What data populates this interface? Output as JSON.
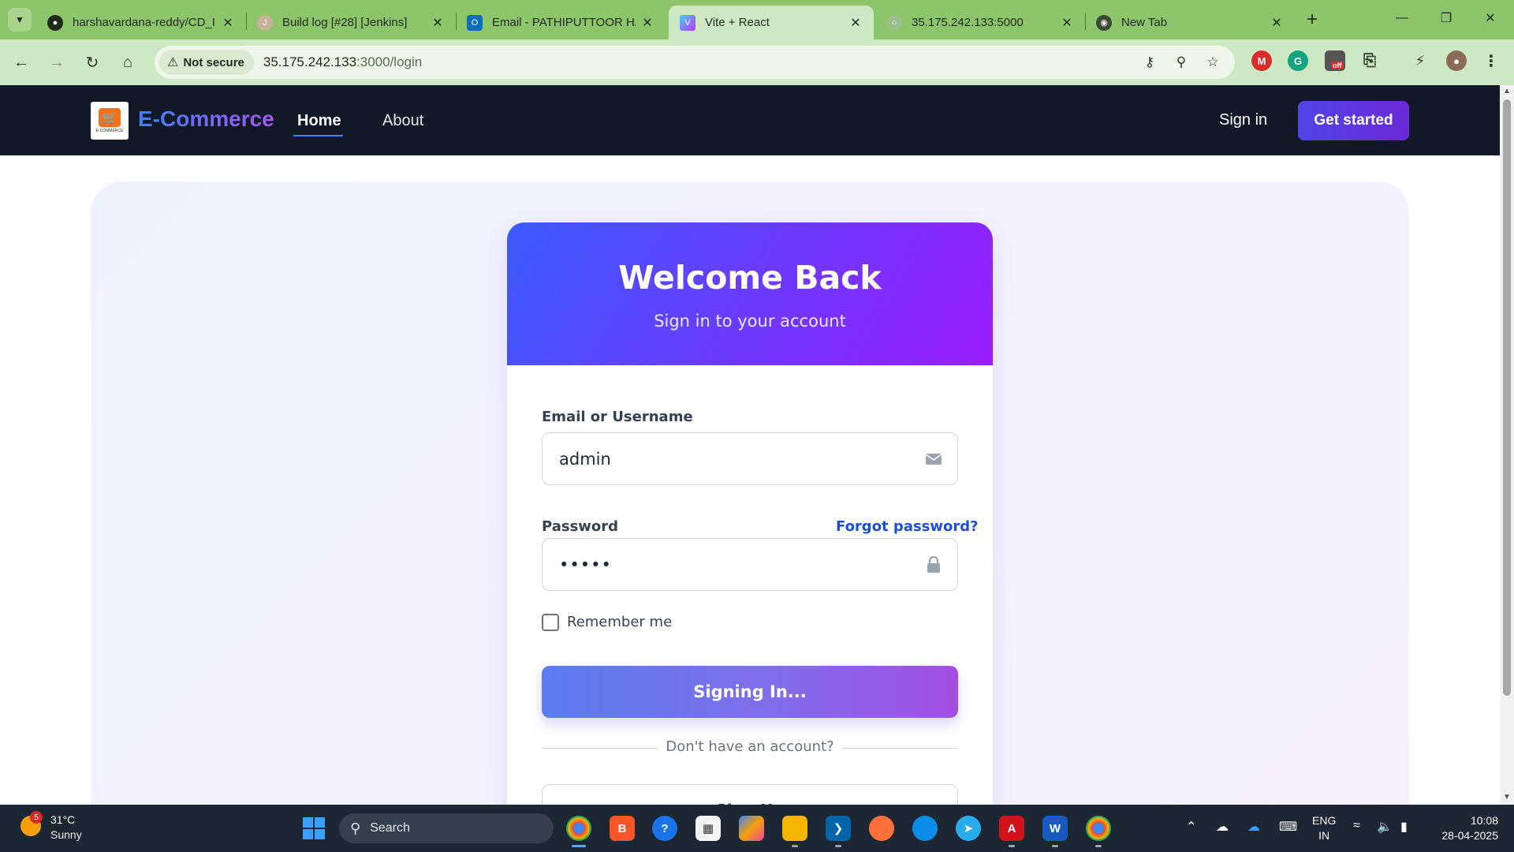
{
  "browser": {
    "tabs": [
      {
        "title": "harshavardana-reddy/CD_I",
        "icon": "github-icon",
        "active": false
      },
      {
        "title": "Build log [#28] [Jenkins]",
        "icon": "jenkins-icon",
        "active": false
      },
      {
        "title": "Email - PATHIPUTTOOR HA",
        "icon": "outlook-icon",
        "active": false
      },
      {
        "title": "Vite + React",
        "icon": "vite-icon",
        "active": true
      },
      {
        "title": "35.175.242.133:5000",
        "icon": "globe-icon",
        "active": false
      },
      {
        "title": "New Tab",
        "icon": "chrome-icon",
        "active": false
      }
    ],
    "security_chip": "Not secure",
    "url_host": "35.175.242.133",
    "url_path": ":3000/login",
    "ext_badge": "off"
  },
  "navbar": {
    "brand": "E-Commerce",
    "logo_caption": "E-COMMERCE",
    "links": [
      "Home",
      "About"
    ],
    "signin": "Sign in",
    "cta": "Get started",
    "accent": "#3b82f6"
  },
  "login": {
    "title": "Welcome Back",
    "subtitle": "Sign in to your account",
    "email_label": "Email or Username",
    "email_value": "admin",
    "password_label": "Password",
    "password_value": "•••••",
    "forgot": "Forgot password?",
    "remember": "Remember me",
    "submit": "Signing In...",
    "divider": "Don't have an account?",
    "signup": "Sign Up"
  },
  "taskbar": {
    "weather_temp": "31°C",
    "weather_desc": "Sunny",
    "weather_badge": "5",
    "search": "Search",
    "lang_1": "ENG",
    "lang_2": "IN",
    "time": "10:08",
    "date": "28-04-2025"
  }
}
